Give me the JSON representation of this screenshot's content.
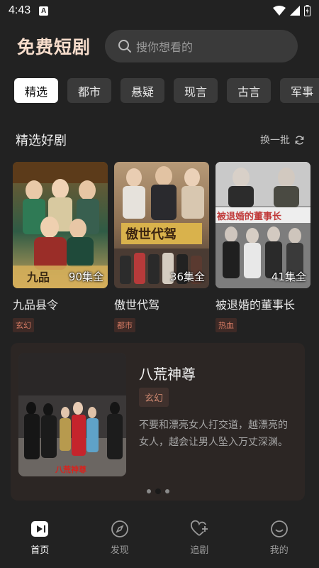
{
  "status_bar": {
    "time": "4:43",
    "notif_letter": "A"
  },
  "header": {
    "title": "免费短剧",
    "search_placeholder": "搜你想看的"
  },
  "tabs": [
    {
      "label": "精选",
      "active": true
    },
    {
      "label": "都市"
    },
    {
      "label": "悬疑"
    },
    {
      "label": "现言"
    },
    {
      "label": "古言"
    },
    {
      "label": "军事"
    }
  ],
  "section": {
    "title": "精选好剧",
    "refresh_label": "换一批"
  },
  "dramas": [
    {
      "title": "九品县令",
      "episodes": "90集全",
      "tag": "玄幻",
      "poster_text": "九品"
    },
    {
      "title": "傲世代驾",
      "episodes": "36集全",
      "tag": "都市",
      "poster_text": "傲世代驾"
    },
    {
      "title": "被退婚的董事长",
      "episodes": "41集全",
      "tag": "热血",
      "poster_text": "被退婚的董事长"
    }
  ],
  "featured": {
    "title": "八荒神尊",
    "tag": "玄幻",
    "description": "不要和漂亮女人打交道，越漂亮的女人，越会让男人坠入万丈深渊。",
    "image_caption": "八荒神尊",
    "pages": 3,
    "active_page": 1
  },
  "bottom_nav": [
    {
      "label": "首页",
      "icon": "play-box-icon",
      "active": true
    },
    {
      "label": "发现",
      "icon": "compass-icon"
    },
    {
      "label": "追剧",
      "icon": "heart-plus-icon"
    },
    {
      "label": "我的",
      "icon": "smile-icon"
    }
  ],
  "colors": {
    "background": "#222222",
    "brand_title": "#f6dccb",
    "tag_text": "#d37a63",
    "tag_bg": "#3e2a26"
  }
}
